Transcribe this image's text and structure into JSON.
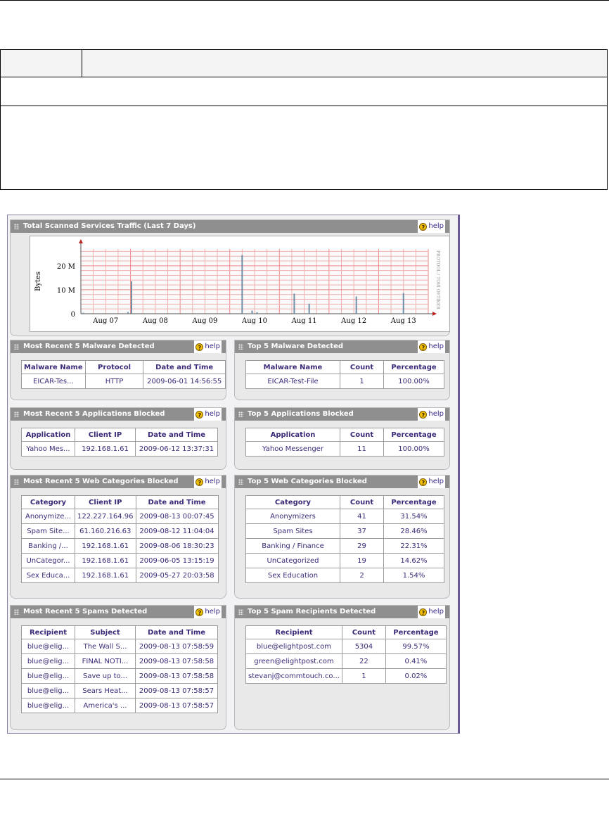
{
  "chart_panel": {
    "title": "Total Scanned Services Traffic (Last 7 Days)",
    "help_label": "help"
  },
  "chart_data": {
    "type": "bar",
    "ylabel": "Bytes",
    "ytick_labels": [
      "0",
      "10 M",
      "20 M"
    ],
    "yticks": [
      0,
      10,
      20
    ],
    "ylim": [
      0,
      27
    ],
    "categories": [
      "Aug 07",
      "Aug 08",
      "Aug 09",
      "Aug 10",
      "Aug 11",
      "Aug 12",
      "Aug 13"
    ],
    "xlim": [
      0,
      7
    ],
    "watermark": "PROTOOL / TOBI OETIKER",
    "grid": true,
    "bars_day_offset_and_megabytes": [
      {
        "x": 0.05,
        "y": 0.4
      },
      {
        "x": 0.95,
        "y": 0.7
      },
      {
        "x": 1.02,
        "y": 13.5
      },
      {
        "x": 3.25,
        "y": 24.5
      },
      {
        "x": 3.45,
        "y": 1.3
      },
      {
        "x": 3.55,
        "y": 0.6
      },
      {
        "x": 4.3,
        "y": 8.4
      },
      {
        "x": 4.6,
        "y": 4.2
      },
      {
        "x": 5.55,
        "y": 7.2
      },
      {
        "x": 6.5,
        "y": 8.6
      }
    ]
  },
  "panels": {
    "recent_malware": {
      "title": "Most Recent 5 Malware Detected",
      "help_label": "help",
      "headers": [
        "Malware Name",
        "Protocol",
        "Date and Time"
      ],
      "rows": [
        [
          "EICAR-Tes...",
          "HTTP",
          "2009-06-01 14:56:55"
        ]
      ]
    },
    "top_malware": {
      "title": "Top 5 Malware Detected",
      "help_label": "help",
      "headers": [
        "Malware Name",
        "Count",
        "Percentage"
      ],
      "rows": [
        [
          "EICAR-Test-File",
          "1",
          "100.00%"
        ]
      ]
    },
    "recent_apps": {
      "title": "Most Recent 5 Applications Blocked",
      "help_label": "help",
      "headers": [
        "Application",
        "Client IP",
        "Date and Time"
      ],
      "rows": [
        [
          "Yahoo Mes...",
          "192.168.1.61",
          "2009-06-12 13:37:31"
        ]
      ]
    },
    "top_apps": {
      "title": "Top 5 Applications Blocked",
      "help_label": "help",
      "headers": [
        "Application",
        "Count",
        "Percentage"
      ],
      "rows": [
        [
          "Yahoo Messenger",
          "11",
          "100.00%"
        ]
      ]
    },
    "recent_web": {
      "title": "Most Recent 5 Web Categories Blocked",
      "help_label": "help",
      "headers": [
        "Category",
        "Client IP",
        "Date and Time"
      ],
      "rows": [
        [
          "Anonymize...",
          "122.227.164.96",
          "2009-08-13 00:07:45"
        ],
        [
          "Spam Site...",
          "61.160.216.63",
          "2009-08-12 11:04:04"
        ],
        [
          "Banking /...",
          "192.168.1.61",
          "2009-08-06 18:30:23"
        ],
        [
          "UnCategor...",
          "192.168.1.61",
          "2009-06-05 13:15:19"
        ],
        [
          "Sex Educa...",
          "192.168.1.61",
          "2009-05-27 20:03:58"
        ]
      ]
    },
    "top_web": {
      "title": "Top 5 Web Categories Blocked",
      "help_label": "help",
      "headers": [
        "Category",
        "Count",
        "Percentage"
      ],
      "rows": [
        [
          "Anonymizers",
          "41",
          "31.54%"
        ],
        [
          "Spam Sites",
          "37",
          "28.46%"
        ],
        [
          "Banking / Finance",
          "29",
          "22.31%"
        ],
        [
          "UnCategorized",
          "19",
          "14.62%"
        ],
        [
          "Sex Education",
          "2",
          "1.54%"
        ]
      ]
    },
    "recent_spam": {
      "title": "Most Recent 5 Spams Detected",
      "help_label": "help",
      "headers": [
        "Recipient",
        "Subject",
        "Date and Time"
      ],
      "rows": [
        [
          "blue@elig...",
          "The Wall S...",
          "2009-08-13 07:58:59"
        ],
        [
          "blue@elig...",
          "FINAL NOTI...",
          "2009-08-13 07:58:58"
        ],
        [
          "blue@elig...",
          "Save up to...",
          "2009-08-13 07:58:58"
        ],
        [
          "blue@elig...",
          "Sears Heat...",
          "2009-08-13 07:58:57"
        ],
        [
          "blue@elig...",
          "America's ...",
          "2009-08-13 07:58:57"
        ]
      ]
    },
    "top_spam": {
      "title": "Top 5 Spam Recipients Detected",
      "help_label": "help",
      "headers": [
        "Recipient",
        "Count",
        "Percentage"
      ],
      "rows": [
        [
          "blue@elightpost.com",
          "5304",
          "99.57%"
        ],
        [
          "green@elightpost.com",
          "22",
          "0.41%"
        ],
        [
          "stevanj@commtouch.co...",
          "1",
          "0.02%"
        ]
      ]
    }
  },
  "colors": {
    "panel_header": "#8f8f8f",
    "panel_body": "#e9e9e9",
    "table_text": "#3c2a78",
    "grid_line": "#f2b0b0",
    "bar_color": "#6f8fa8"
  }
}
